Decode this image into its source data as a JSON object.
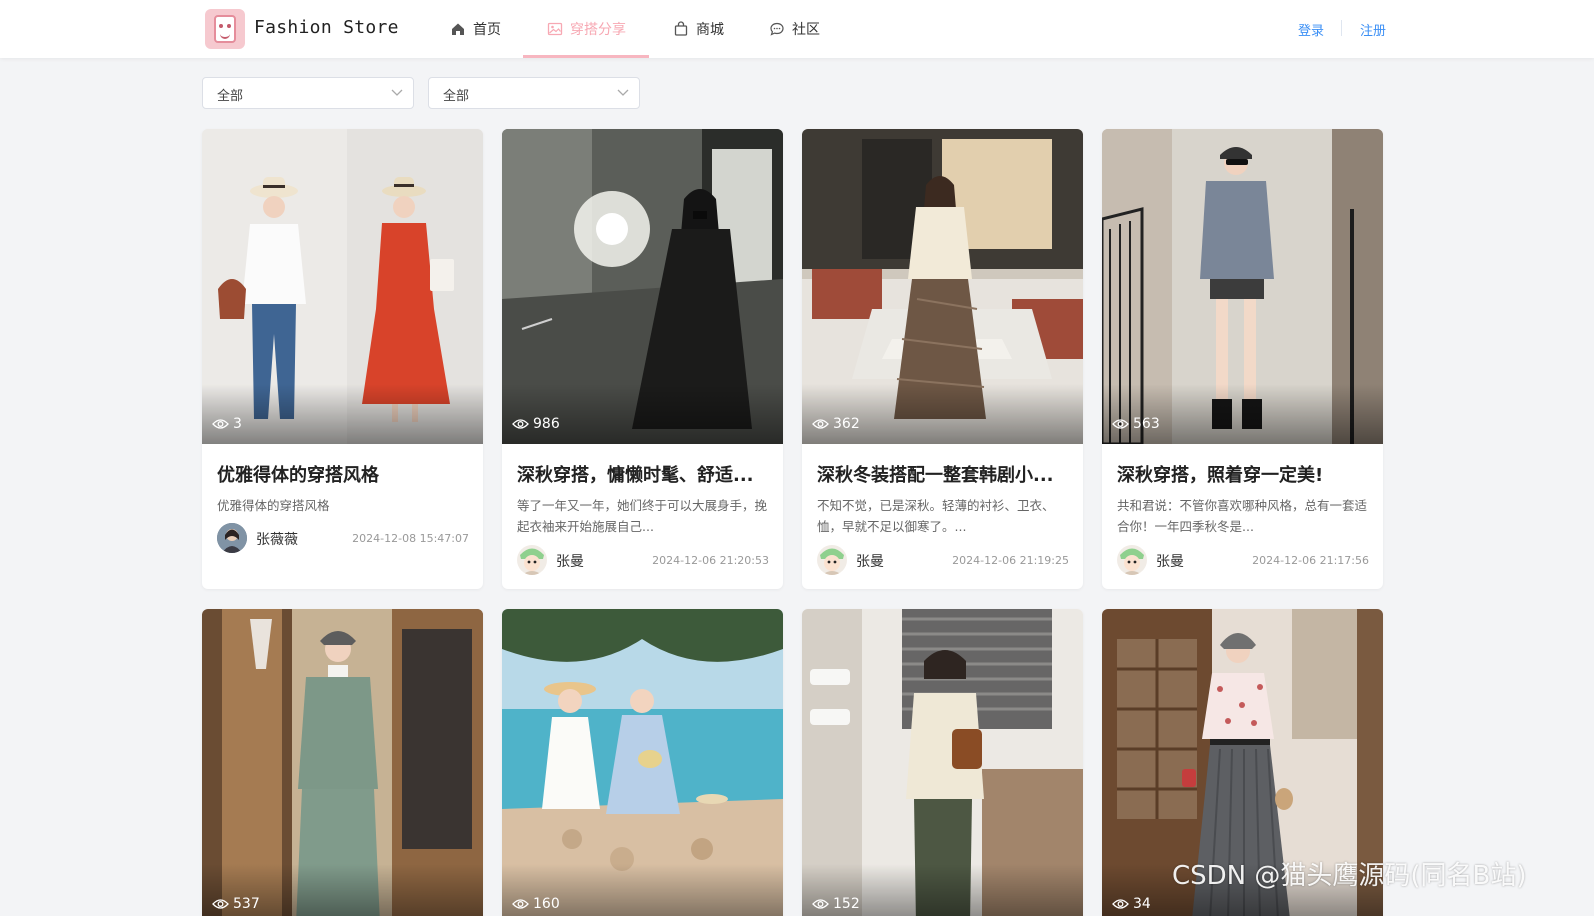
{
  "header": {
    "brand": "Fashion Store",
    "nav": [
      {
        "label": "首页",
        "icon": "home-icon"
      },
      {
        "label": "穿搭分享",
        "icon": "image-icon",
        "active": true
      },
      {
        "label": "商城",
        "icon": "shopping-bag-icon"
      },
      {
        "label": "社区",
        "icon": "chat-bubble-icon"
      }
    ],
    "login": "登录",
    "register": "注册"
  },
  "filters": [
    {
      "value": "全部"
    },
    {
      "value": "全部"
    }
  ],
  "posts": [
    {
      "views": "3",
      "title": "优雅得体的穿搭风格",
      "desc": "优雅得体的穿搭风格",
      "author": "张薇薇",
      "date": "2024-12-08 15:47:07"
    },
    {
      "views": "986",
      "title": "深秋穿搭，慵懒时髦、舒适...",
      "desc": "等了一年又一年，她们终于可以大展身手，挽起衣袖来开始施展自己...",
      "author": "张曼",
      "date": "2024-12-06 21:20:53"
    },
    {
      "views": "362",
      "title": "深秋冬装搭配一整套韩剧小...",
      "desc": "不知不觉，已是深秋。轻薄的衬衫、卫衣、恤，早就不足以御寒了。...",
      "author": "张曼",
      "date": "2024-12-06 21:19:25"
    },
    {
      "views": "563",
      "title": "深秋穿搭，照着穿一定美!",
      "desc": "共和君说：不管你喜欢哪种风格，总有一套适合你！一年四季秋冬是...",
      "author": "张曼",
      "date": "2024-12-06 21:17:56"
    },
    {
      "views": "537"
    },
    {
      "views": "160"
    },
    {
      "views": "152"
    },
    {
      "views": "34"
    }
  ],
  "watermark": "CSDN @猫头鹰源码(同名B站)",
  "colors": {
    "accent": "#f7a8b3",
    "link": "#3b8ff5",
    "background": "#f3f4f6"
  }
}
